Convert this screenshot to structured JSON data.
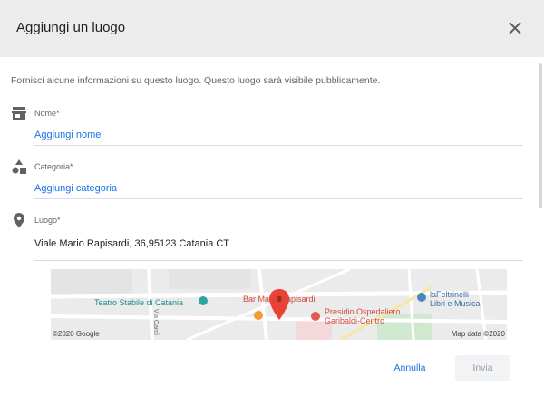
{
  "dialog": {
    "title": "Aggiungi un luogo",
    "intro": "Fornisci alcune informazioni su questo luogo. Questo luogo sarà visibile pubblicamente."
  },
  "fields": {
    "name": {
      "label": "Nome*",
      "value": "Aggiungi nome",
      "icon": "store-icon"
    },
    "category": {
      "label": "Categoria*",
      "value": "Aggiungi categoria",
      "icon": "shapes-icon"
    },
    "location": {
      "label": "Luogo*",
      "value": "Viale Mario Rapisardi, 36,95123 Catania CT",
      "icon": "location-pin-icon"
    }
  },
  "map": {
    "labels": {
      "theatre": "Teatro Stabile di Catania",
      "bar": "Bar Mario Rapisardi",
      "hospital_line1": "Presidio Ospedaliero",
      "hospital_line2": "Garibaldi-Centro",
      "bookstore_line1": "laFeltrinelli",
      "bookstore_line2": "Libri e Musica",
      "road": "Via Cardì"
    },
    "credit_left": "©2020 Google",
    "credit_right": "Map data ©2020"
  },
  "actions": {
    "cancel": "Annulla",
    "send": "Invia"
  },
  "colors": {
    "accent": "#1a73e8",
    "header_bg": "#ececec",
    "pin": "#ea4335"
  }
}
